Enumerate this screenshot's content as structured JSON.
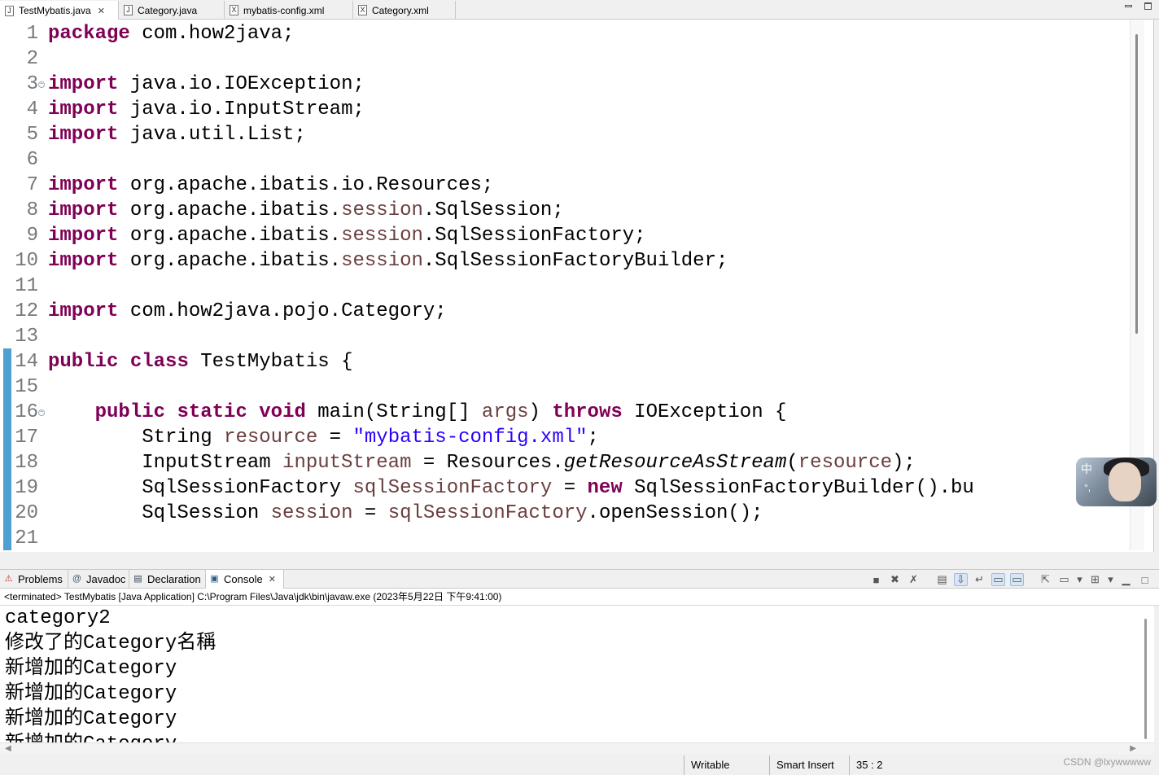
{
  "editor_tabs": [
    {
      "label": "TestMybatis.java",
      "icon": "java-file-icon",
      "active": true
    },
    {
      "label": "Category.java",
      "icon": "java-file-icon",
      "active": false
    },
    {
      "label": "mybatis-config.xml",
      "icon": "xml-file-icon",
      "active": false
    },
    {
      "label": "Category.xml",
      "icon": "xml-file-icon",
      "active": false
    }
  ],
  "code_lines": [
    {
      "n": "1",
      "code": "package com.how2java;"
    },
    {
      "n": "2",
      "code": ""
    },
    {
      "n": "3",
      "code": "import java.io.IOException;"
    },
    {
      "n": "4",
      "code": "import java.io.InputStream;"
    },
    {
      "n": "5",
      "code": "import java.util.List;"
    },
    {
      "n": "6",
      "code": ""
    },
    {
      "n": "7",
      "code": "import org.apache.ibatis.io.Resources;"
    },
    {
      "n": "8",
      "code": "import org.apache.ibatis.session.SqlSession;"
    },
    {
      "n": "9",
      "code": "import org.apache.ibatis.session.SqlSessionFactory;"
    },
    {
      "n": "10",
      "code": "import org.apache.ibatis.session.SqlSessionFactoryBuilder;"
    },
    {
      "n": "11",
      "code": ""
    },
    {
      "n": "12",
      "code": "import com.how2java.pojo.Category;"
    },
    {
      "n": "13",
      "code": ""
    },
    {
      "n": "14",
      "code": "public class TestMybatis {"
    },
    {
      "n": "15",
      "code": ""
    },
    {
      "n": "16",
      "code": "    public static void main(String[] args) throws IOException {"
    },
    {
      "n": "17",
      "code": "        String resource = \"mybatis-config.xml\";"
    },
    {
      "n": "18",
      "code": "        InputStream inputStream = Resources.getResourceAsStream(resource);"
    },
    {
      "n": "19",
      "code": "        SqlSessionFactory sqlSessionFactory = new SqlSessionFactoryBuilder().bu"
    },
    {
      "n": "20",
      "code": "        SqlSession session = sqlSessionFactory.openSession();"
    },
    {
      "n": "21",
      "code": ""
    }
  ],
  "view_tabs": [
    {
      "label": "Problems",
      "icon": "problems-icon",
      "active": false
    },
    {
      "label": "Javadoc",
      "icon": "at-icon",
      "active": false
    },
    {
      "label": "Declaration",
      "icon": "declaration-icon",
      "active": false
    },
    {
      "label": "Console",
      "icon": "console-icon",
      "active": true
    }
  ],
  "console": {
    "header": "<terminated> TestMybatis [Java Application] C:\\Program Files\\Java\\jdk\\bin\\javaw.exe (2023年5月22日 下午9:41:00)",
    "lines": [
      "category2",
      "修改了的Category名稱",
      "新增加的Category",
      "新增加的Category",
      "新增加的Category",
      "新增加的Category"
    ]
  },
  "avatar_overlay": {
    "ime_label": "中",
    "ime_hint": "°,"
  },
  "status_bar": {
    "mode": "Writable",
    "insert": "Smart Insert",
    "position": "35 : 2",
    "watermark": "CSDN @lxywwwww"
  },
  "colors": {
    "keyword": "#7f0055",
    "string": "#2a00ff",
    "field": "#6a3e3e",
    "gutter_marker": "#4f9fd0"
  }
}
